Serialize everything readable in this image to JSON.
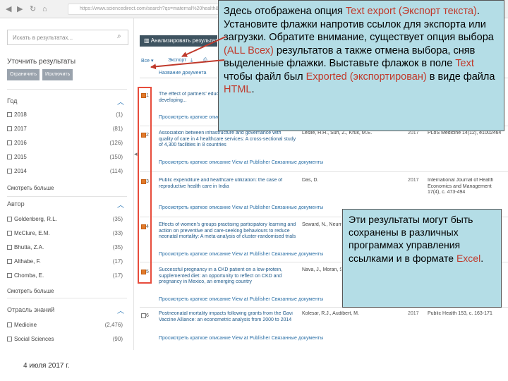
{
  "browser": {
    "url": "https://www.sciencedirect.com/search?qs=maternal%20health&origin=home"
  },
  "sidebar": {
    "search_placeholder": "Искать в результатах...",
    "refine_title": "Уточнить результаты",
    "pill_limit": "Ограничить",
    "pill_exclude": "Исключить",
    "year": {
      "heading": "Год",
      "items": [
        {
          "label": "2018",
          "count": "(1)"
        },
        {
          "label": "2017",
          "count": "(81)"
        },
        {
          "label": "2016",
          "count": "(126)"
        },
        {
          "label": "2015",
          "count": "(150)"
        },
        {
          "label": "2014",
          "count": "(114)"
        }
      ],
      "more": "Смотреть больше"
    },
    "author": {
      "heading": "Автор",
      "items": [
        {
          "label": "Goldenberg, R.L.",
          "count": "(35)"
        },
        {
          "label": "McClure, E.M.",
          "count": "(33)"
        },
        {
          "label": "Bhutta, Z.A.",
          "count": "(35)"
        },
        {
          "label": "Althabe, F.",
          "count": "(17)"
        },
        {
          "label": "Chomba, E.",
          "count": "(17)"
        }
      ],
      "more": "Смотреть больше"
    },
    "field": {
      "heading": "Отрасль знаний",
      "items": [
        {
          "label": "Medicine",
          "count": "(2,476)"
        },
        {
          "label": "Social Sciences",
          "count": "(90)"
        }
      ]
    }
  },
  "toolbar": {
    "analyze_label": "Анализировать результаты",
    "all_label": "Все",
    "export_label": "Экспорт",
    "column_title": "Название документа"
  },
  "results": [
    {
      "num": "1",
      "title": "The effect of partners' education... maternal health in developing...",
      "authors": "",
      "year": "",
      "source": "",
      "actions": "Просмотреть краткое описание",
      "checked": true
    },
    {
      "num": "2",
      "title": "Association between infrastructure and governance with quality of care in 4 healthcare services: A cross-sectional study of 4,300 facilities in 8 countries",
      "authors": "Leslie, H.H., Sun, Z., Kruk, M.E.",
      "year": "2017",
      "source": "PLoS Medicine 14(12), e1002464",
      "actions": "Просмотреть краткое описание   View at Publisher   Связанные документы",
      "checked": true
    },
    {
      "num": "3",
      "title": "Public expenditure and healthcare utilization: the case of reproductive health care in India",
      "authors": "Das, D.",
      "year": "2017",
      "source": "International Journal of Health Economics and Management 17(4), c. 473-494",
      "actions": "Просмотреть краткое описание   View at Publisher   Связанные документы",
      "checked": true
    },
    {
      "num": "4",
      "title": "Effects of women's groups practising participatory learning and action on preventive and care-seeking behaviours to reduce neonatal mortality: A meta-analysis of cluster-randomised trials",
      "authors": "Seward, N., Neuman... Tripathy, P., ...",
      "year": "",
      "source": "",
      "actions": "Просмотреть краткое описание   View at Publisher   Связанные документы",
      "checked": true
    },
    {
      "num": "5",
      "title": "Successful pregnancy in a CKD patient on a low-protein, supplemented diet: an opportunity to reflect on CKD and pregnancy in Mexico, an emerging country",
      "authors": "Nava, J., Moran, S., ... Montufar, R., Pina...",
      "year": "",
      "source": "",
      "actions": "Просмотреть краткое описание   View at Publisher   Связанные документы",
      "checked": true
    },
    {
      "num": "6",
      "title": "Postneonatal mortality impacts following grants from the Gavi Vaccine Alliance: an econometric analysis from 2000 to 2014",
      "authors": "Kolesar, R.J., Audibert, M.",
      "year": "2017",
      "source": "Public Health 153, c. 163-171",
      "actions": "Просмотреть краткое описание   View at Publisher   Связанные документы",
      "checked": false
    }
  ],
  "callout_export": {
    "p1": "Здесь отображена опция ",
    "p2": "Text export (Экспорт текста)",
    "p3": ". Установите флажки напротив ссылок для экспорта или загрузки.  Обратите внимание, существует опция выбора ",
    "p4": "(ALL Всех)",
    "p5": " результатов а также отмена выбора, сняв выделенные флажки. Выставьте флажок в поле ",
    "p6": "Text",
    "p7": " чтобы файл был ",
    "p8": "Exported (экспортирован)",
    "p9": " в виде файла ",
    "p10": "HTML",
    "p11": "."
  },
  "callout_save": {
    "p1": "Эти результаты могут быть сохранены в различных программах управления ссылками и в формате ",
    "p2": "Excel",
    "p3": "."
  },
  "footer": {
    "date": "4 июля 2017 г."
  },
  "colors": {
    "callout_bg": "#b4dde6",
    "accent_red": "#c0392b",
    "checkbox_orange": "#e07a2c"
  }
}
